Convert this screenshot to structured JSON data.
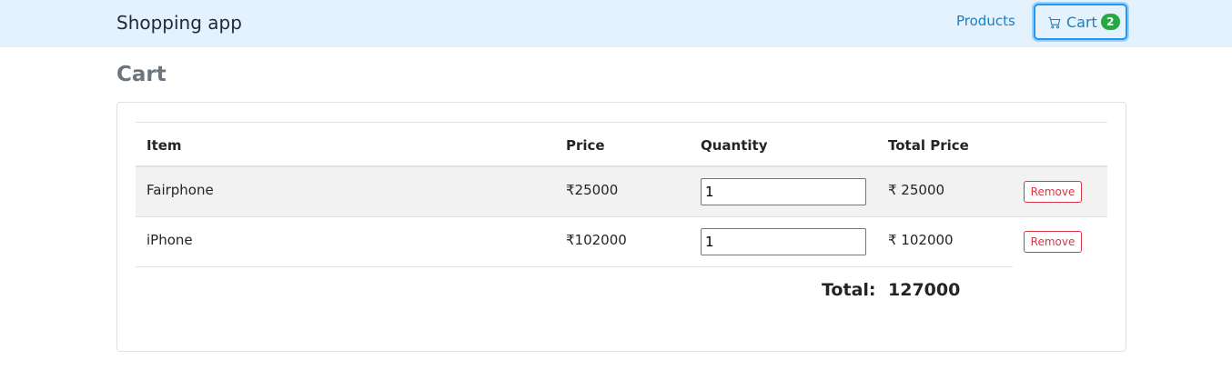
{
  "navbar": {
    "brand": "Shopping app",
    "products_link": "Products",
    "cart_label": "Cart",
    "cart_count": "2"
  },
  "page": {
    "title": "Cart"
  },
  "table": {
    "headers": [
      "Item",
      "Price",
      "Quantity",
      "Total Price"
    ],
    "rows": [
      {
        "item": "Fairphone",
        "price": "₹25000",
        "quantity": "1",
        "total": "₹ 25000",
        "action": "Remove"
      },
      {
        "item": "iPhone",
        "price": "₹102000",
        "quantity": "1",
        "total": "₹ 102000",
        "action": "Remove"
      }
    ],
    "total_label": "Total:",
    "total_value": "127000"
  },
  "colors": {
    "navbar_bg": "#e3f2fd",
    "link": "#1a7fc1",
    "badge": "#28a745",
    "danger": "#dc3545"
  }
}
